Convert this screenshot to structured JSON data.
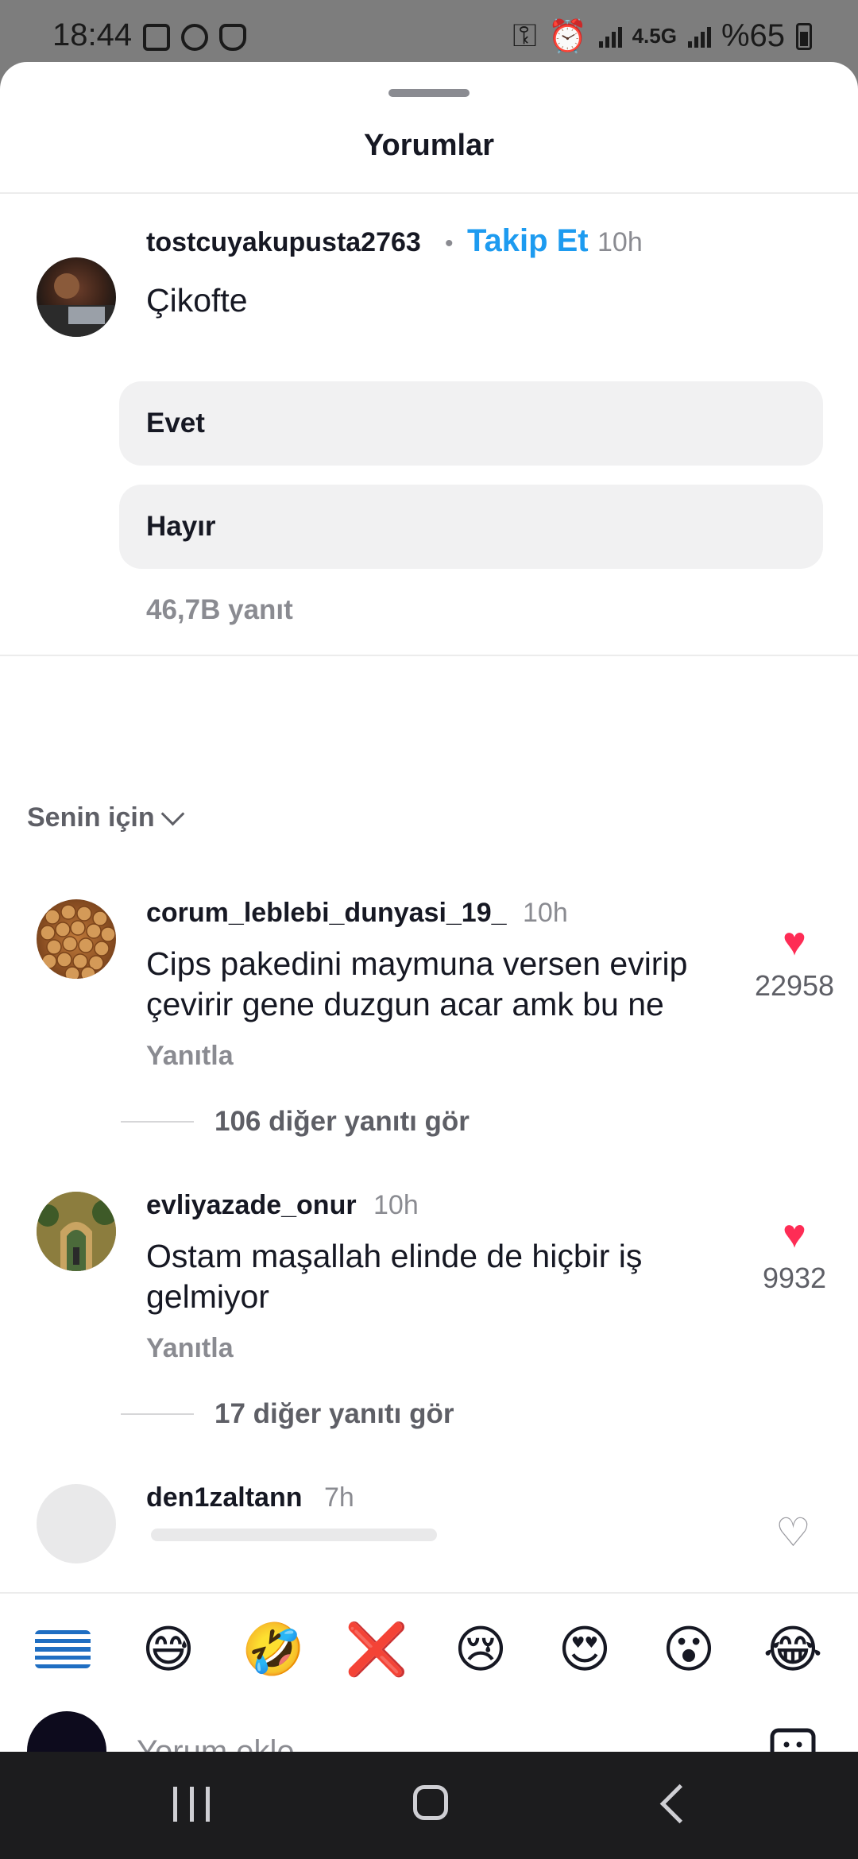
{
  "status_bar": {
    "time": "18:44",
    "network_label": "4.5G",
    "battery": "%65"
  },
  "sheet": {
    "title": "Yorumlar"
  },
  "pinned": {
    "username": "tostcuyakupusta2763",
    "separator": "•",
    "follow_label": "Takip Et",
    "time": "10h",
    "text": "Çikofte",
    "poll_options": [
      "Evet",
      "Hayır"
    ],
    "reply_count": "46,7B yanıt"
  },
  "sort": {
    "label": "Senin için"
  },
  "comments": [
    {
      "username": "corum_leblebi_dunyasi_19_",
      "time": "10h",
      "text": "Cips pakedini maymuna versen evirip çevirir gene duzgun acar amk bu ne",
      "reply_label": "Yanıtla",
      "likes": "22958",
      "more_replies": "106 diğer yanıtı gör"
    },
    {
      "username": "evliyazade_onur",
      "time": "10h",
      "text": "Ostam maşallah elinde de hiçbir iş gelmiyor",
      "reply_label": "Yanıtla",
      "likes": "9932",
      "more_replies": "17 diğer yanıtı gör"
    },
    {
      "username": "den1zaltann",
      "time": "7h"
    }
  ],
  "emoji_bar": {
    "items": [
      "greek-flag",
      "😅",
      "🤣",
      "❌",
      "😢",
      "😍",
      "😮",
      "😂"
    ]
  },
  "composer": {
    "placeholder": "Yorum ekle..."
  },
  "colors": {
    "accent_follow": "#1d9bf0",
    "like_heart": "#fe2c55",
    "muted_text": "#8a8b91",
    "status_bar_bg": "#7d7d7d",
    "nav_bar_bg": "#1c1c1e"
  },
  "icons": [
    "image-icon",
    "ad-icon",
    "shield-icon",
    "key-icon",
    "alarm-icon",
    "signal-icon",
    "battery-icon",
    "heart-icon",
    "chevron-down-icon",
    "sticker-icon",
    "recents-icon",
    "home-icon",
    "back-icon"
  ]
}
